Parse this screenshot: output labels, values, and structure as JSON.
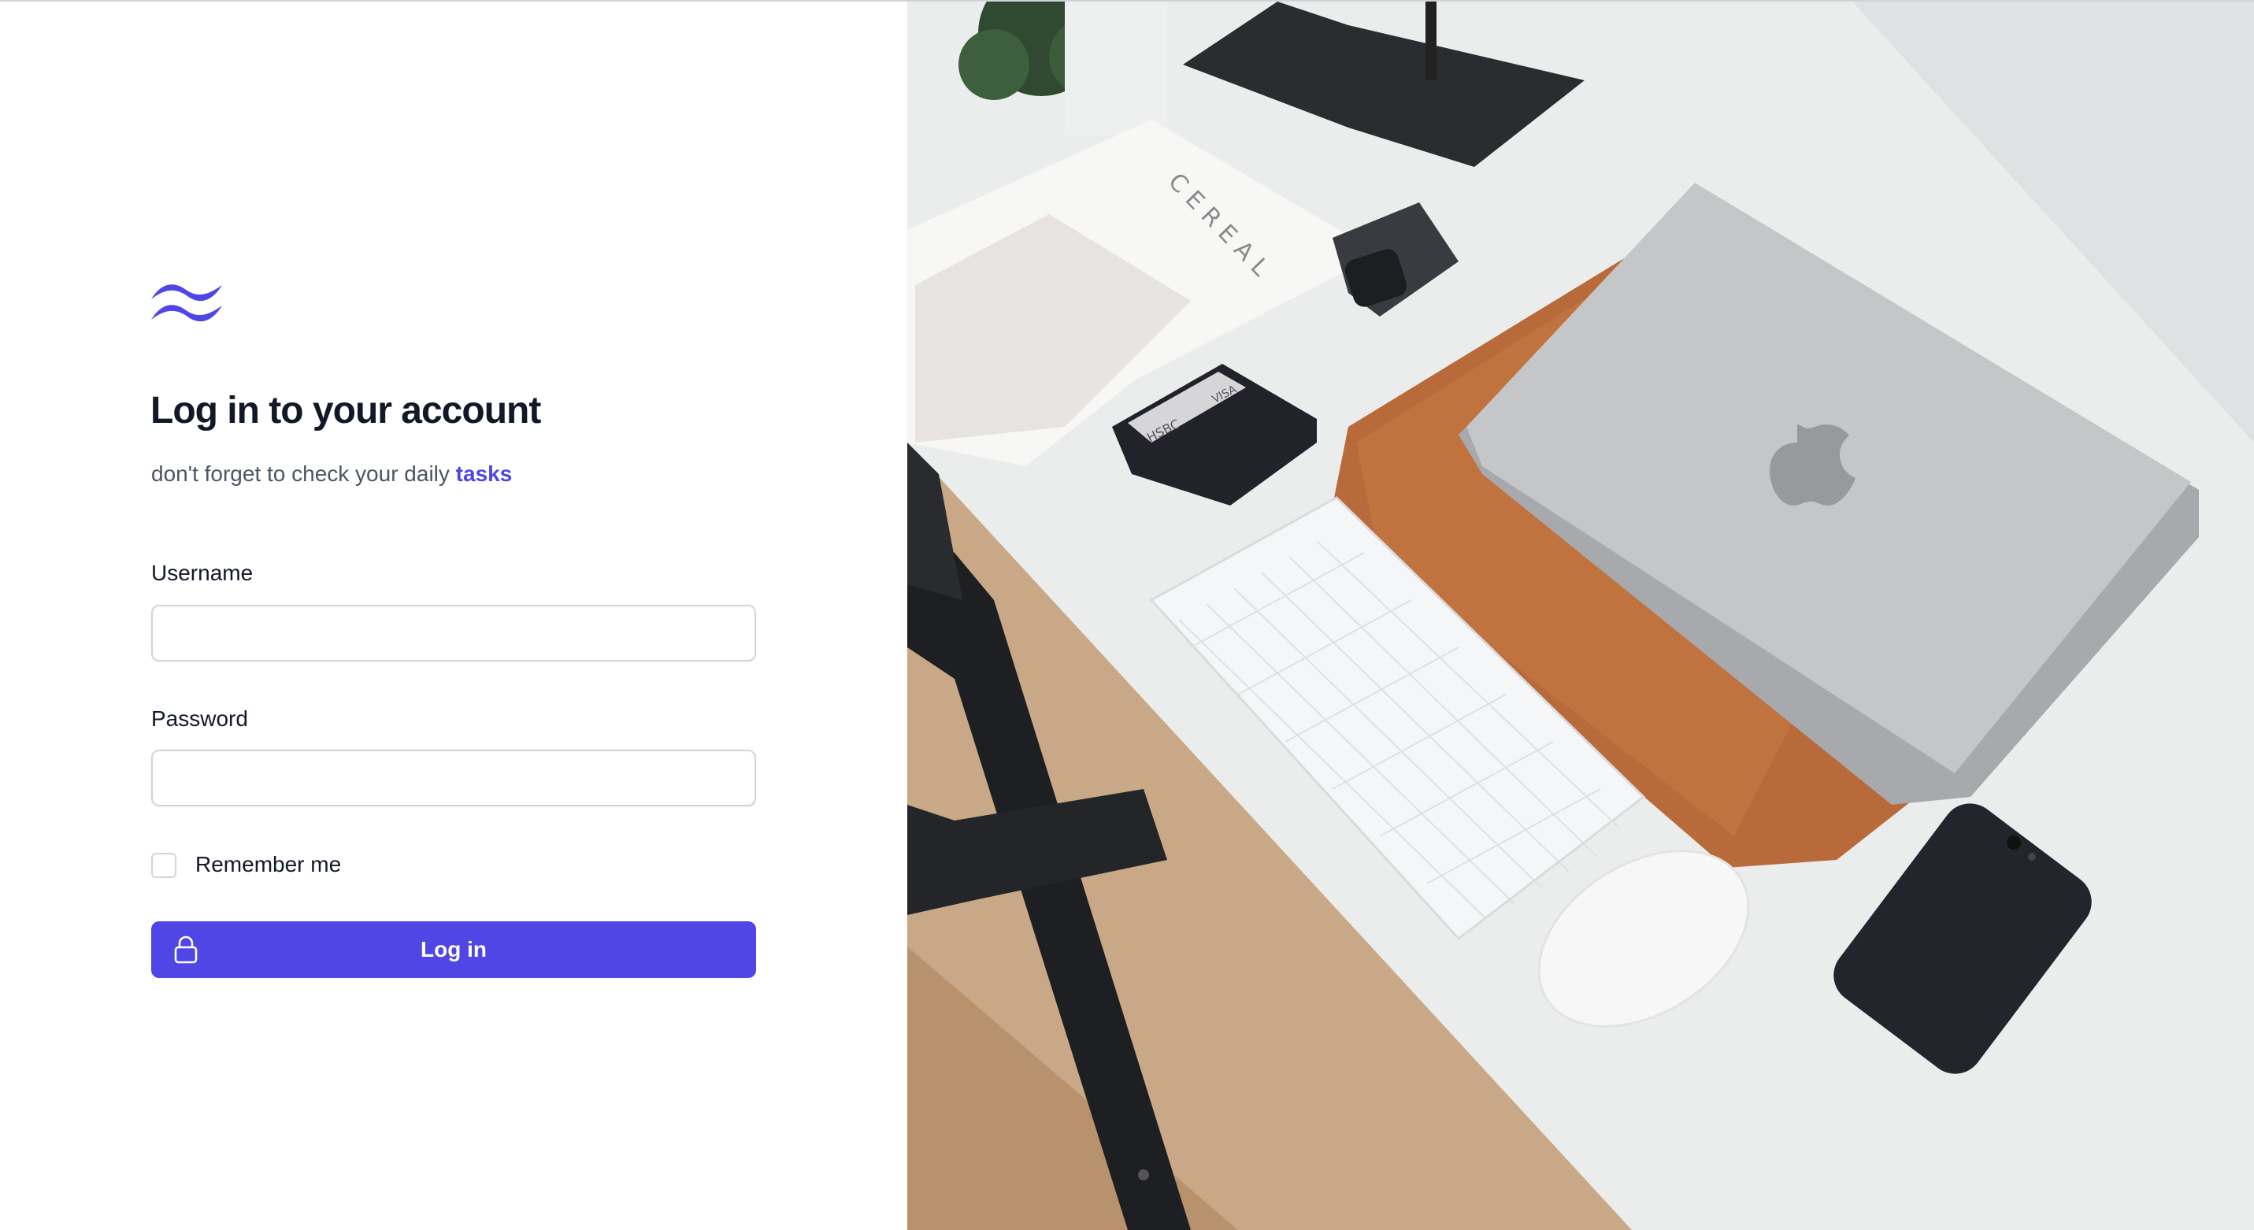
{
  "brand": {
    "logo_icon": "wave-logo-icon",
    "accent_color": "#4f46e5"
  },
  "header": {
    "title": "Log in to your account",
    "subtitle_prefix": "don't forget to check your daily",
    "subtitle_link": "tasks"
  },
  "form": {
    "username_label": "Username",
    "username_value": "",
    "password_label": "Password",
    "password_value": "",
    "remember_label": "Remember me",
    "remember_checked": false,
    "submit_label": "Log in",
    "submit_icon": "lock-icon"
  },
  "photo": {
    "card_text": "HSBC",
    "card_brand": "VISA",
    "book_text": "CEREAL"
  }
}
